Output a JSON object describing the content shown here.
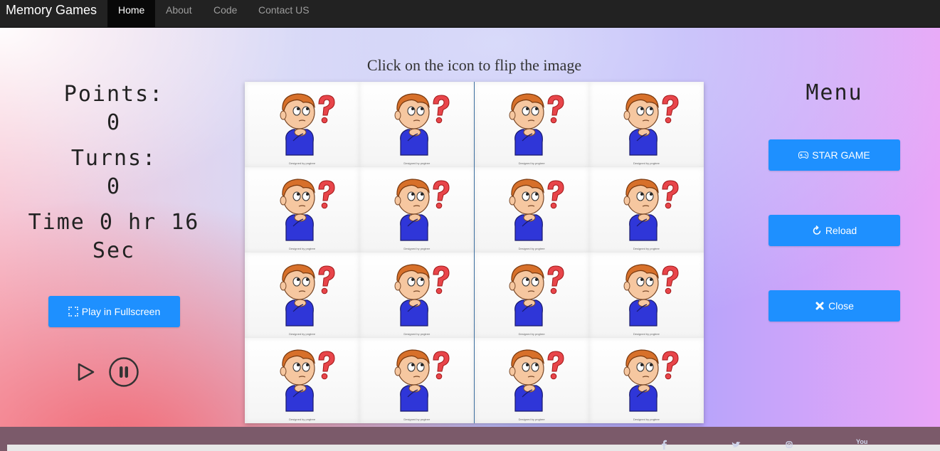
{
  "navbar": {
    "brand": "Memory Games",
    "items": [
      {
        "label": "Home",
        "active": true
      },
      {
        "label": "About",
        "active": false
      },
      {
        "label": "Code",
        "active": false
      },
      {
        "label": "Contact US",
        "active": false
      }
    ]
  },
  "headline": "Click on the icon to flip the image",
  "stats": {
    "points_label": "Points:",
    "points_value": "0",
    "turns_label": "Turns:",
    "turns_value": "0",
    "time_line1": "Time 0 hr 16",
    "time_line2": "Sec"
  },
  "fullscreen_button": "Play in Fullscreen",
  "menu": {
    "title": "Menu",
    "start_button": "STAR GAME",
    "reload_button": "Reload",
    "close_button": "Close"
  },
  "board": {
    "rows": 4,
    "columns": 4,
    "card_face": "thinking-boy-question-mark",
    "card_credit": "Designed by pngtree"
  },
  "footer": {
    "social_icons": [
      "facebook-icon",
      "twitter-icon",
      "instagram-icon",
      "youtube-icon"
    ],
    "youtube_text": "You"
  },
  "colors": {
    "accent": "#1e90ff",
    "navbar": "#222222"
  }
}
